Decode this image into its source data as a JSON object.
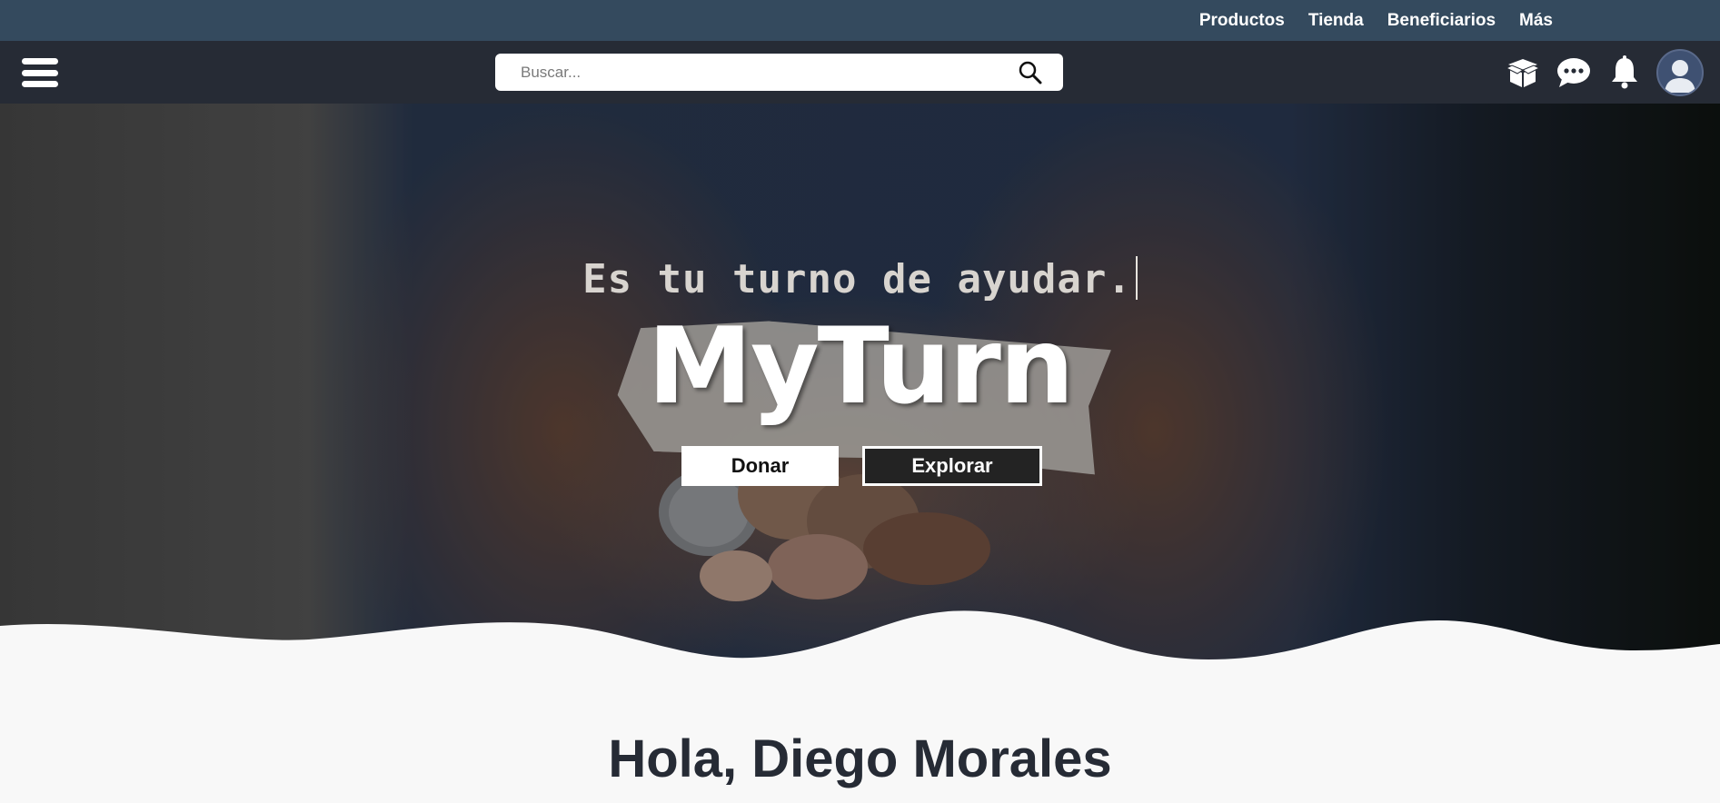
{
  "top_nav": {
    "links": [
      "Productos",
      "Tienda",
      "Beneficiarios",
      "Más"
    ]
  },
  "navbar": {
    "menu_icon": "hamburger-menu-icon",
    "search": {
      "placeholder": "Buscar...",
      "value": "",
      "icon": "search-icon"
    },
    "icons": [
      "box-icon",
      "chat-icon",
      "bell-icon"
    ],
    "avatar_icon": "user-avatar-icon"
  },
  "hero": {
    "tagline": "Es tu turno de ayudar.",
    "brand": "MyTurn",
    "buttons": {
      "donate": "Donar",
      "explore": "Explorar"
    }
  },
  "main": {
    "greeting": "Hola, Diego Morales"
  },
  "colors": {
    "top_bar": "#344a5e",
    "nav_bar": "#262b35",
    "page_bg": "#f8f8f8",
    "text_dark": "#262b35"
  }
}
